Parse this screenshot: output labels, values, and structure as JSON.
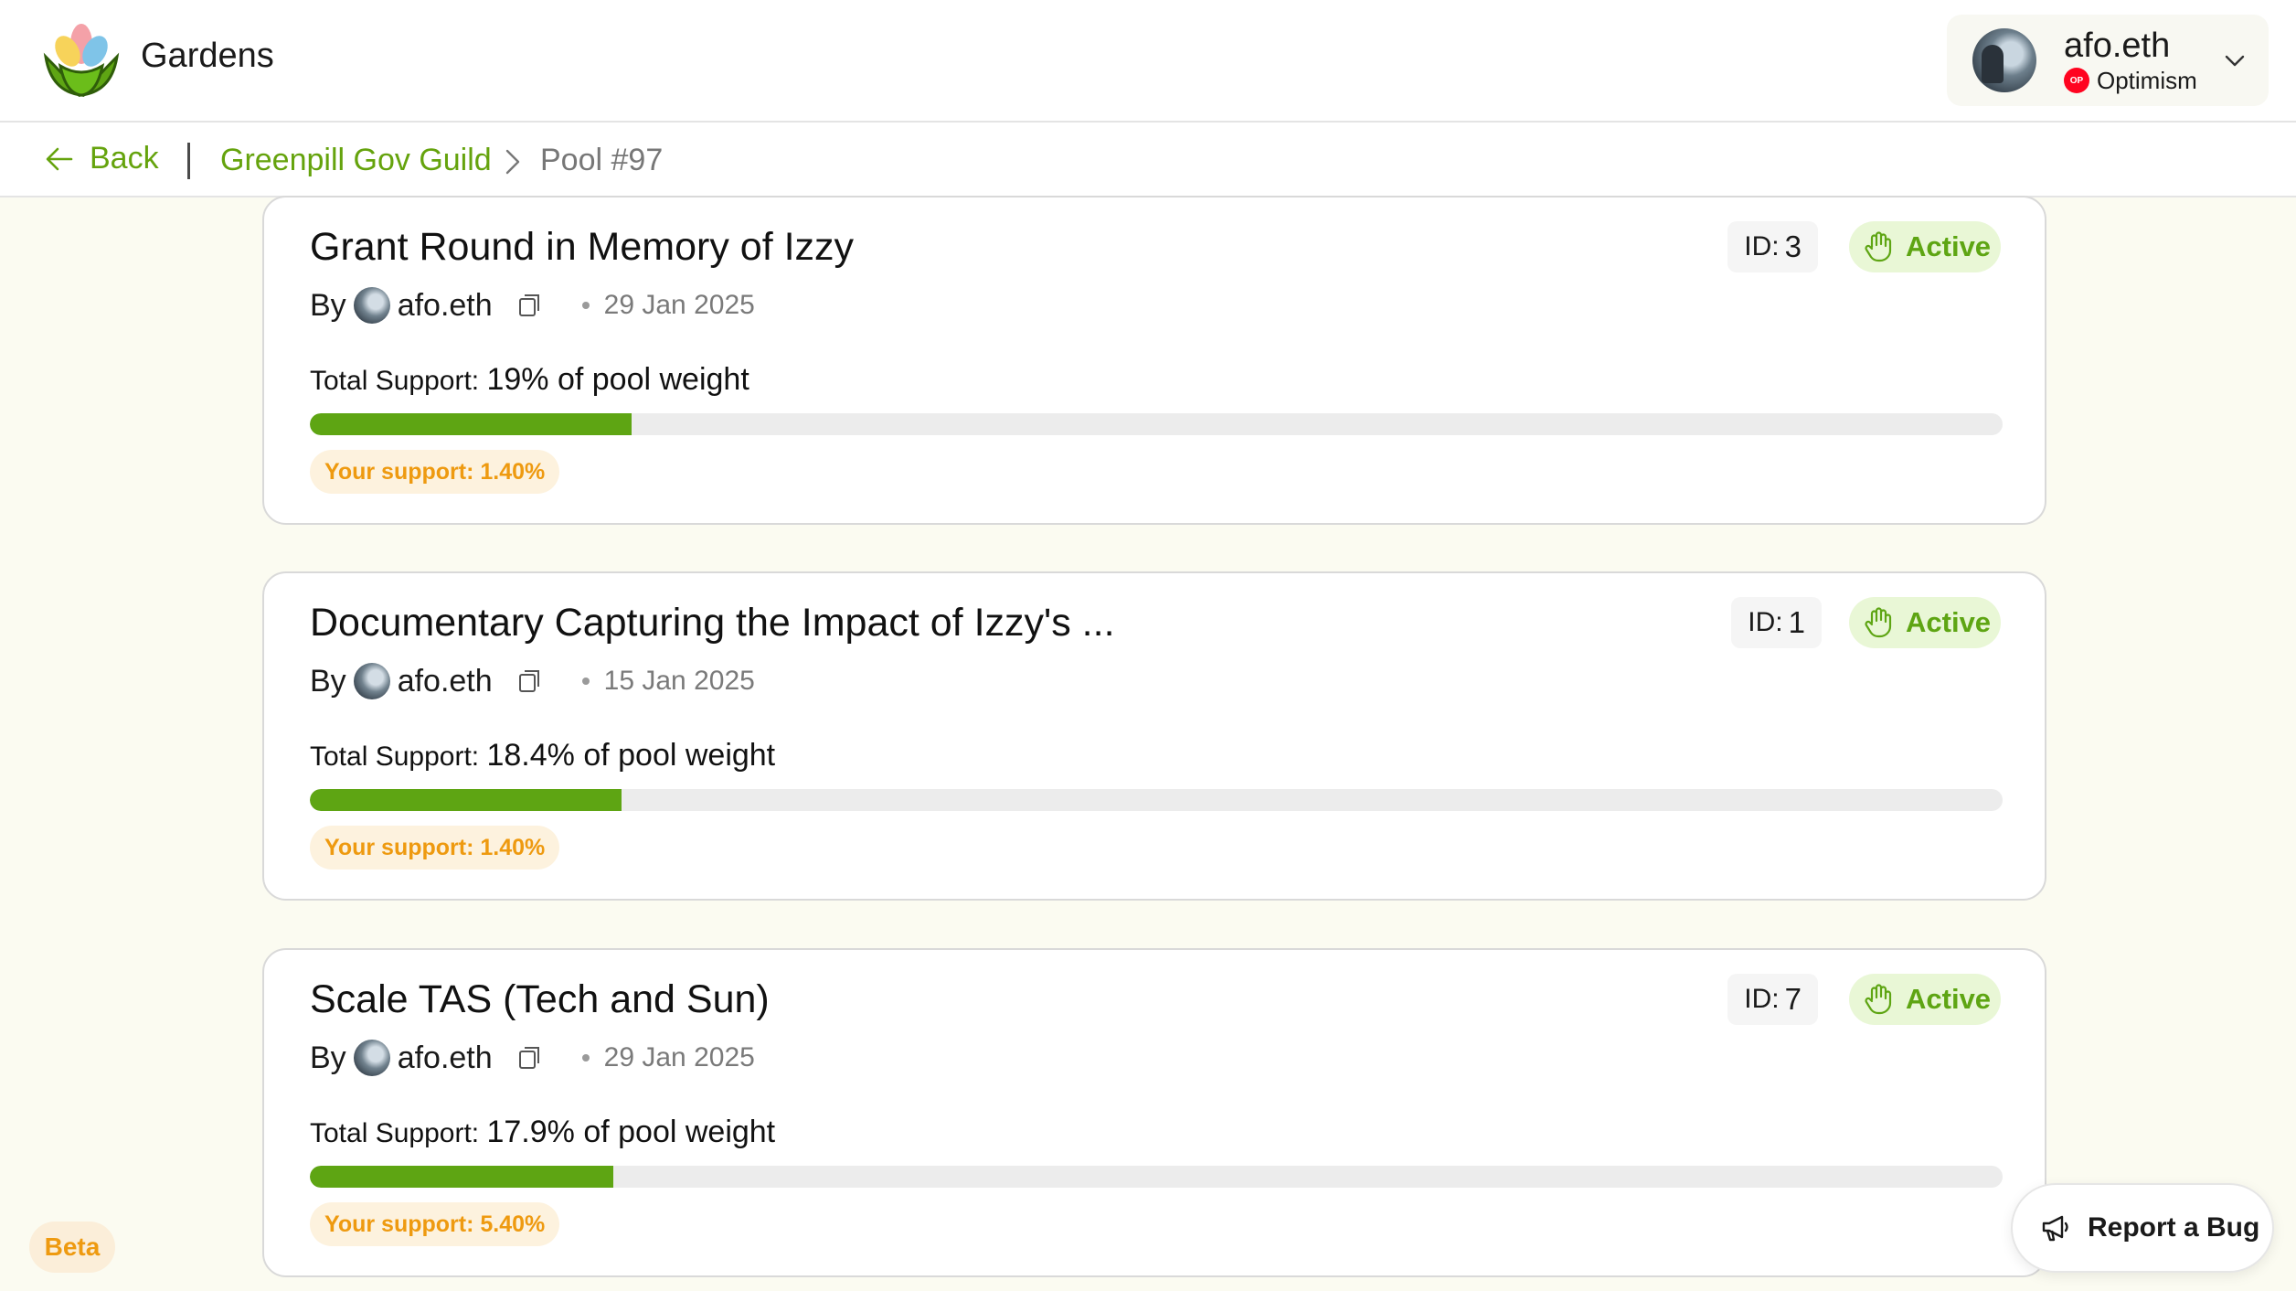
{
  "header": {
    "app_title": "Gardens",
    "account": {
      "name": "afo.eth",
      "network": "Optimism",
      "network_icon_text": "OP"
    }
  },
  "breadcrumb": {
    "back_label": "Back",
    "guild": "Greenpill Gov Guild",
    "pool": "Pool #97"
  },
  "proposals": [
    {
      "title": "Grant Round in Memory of Izzy",
      "by_label": "By",
      "author": "afo.eth",
      "date": "29 Jan 2025",
      "id_label": "ID:",
      "id": "3",
      "status": "Active",
      "total_support_label": "Total Support:",
      "total_support": "19% of pool weight",
      "support_fraction": 0.19,
      "your_support": "Your support: 1.40%"
    },
    {
      "title": "Documentary Capturing the Impact of Izzy's ...",
      "by_label": "By",
      "author": "afo.eth",
      "date": "15 Jan 2025",
      "id_label": "ID:",
      "id": "1",
      "status": "Active",
      "total_support_label": "Total Support:",
      "total_support": "18.4% of pool weight",
      "support_fraction": 0.184,
      "your_support": "Your support: 1.40%"
    },
    {
      "title": "Scale TAS (Tech and Sun)",
      "by_label": "By",
      "author": "afo.eth",
      "date": "29 Jan 2025",
      "id_label": "ID:",
      "id": "7",
      "status": "Active",
      "total_support_label": "Total Support:",
      "total_support": "17.9% of pool weight",
      "support_fraction": 0.179,
      "your_support": "Your support: 5.40%"
    }
  ],
  "footer": {
    "beta": "Beta",
    "report_bug": "Report a Bug"
  },
  "colors": {
    "accent": "#65a30d",
    "bar_fill": "#5ea513",
    "warning": "#ee9a10",
    "background": "#fbfbf1"
  },
  "icons": [
    "gardens-logo-icon",
    "chevron-down-icon",
    "arrow-left-icon",
    "chevron-right-icon",
    "copy-icon",
    "hand-icon",
    "megaphone-icon"
  ]
}
